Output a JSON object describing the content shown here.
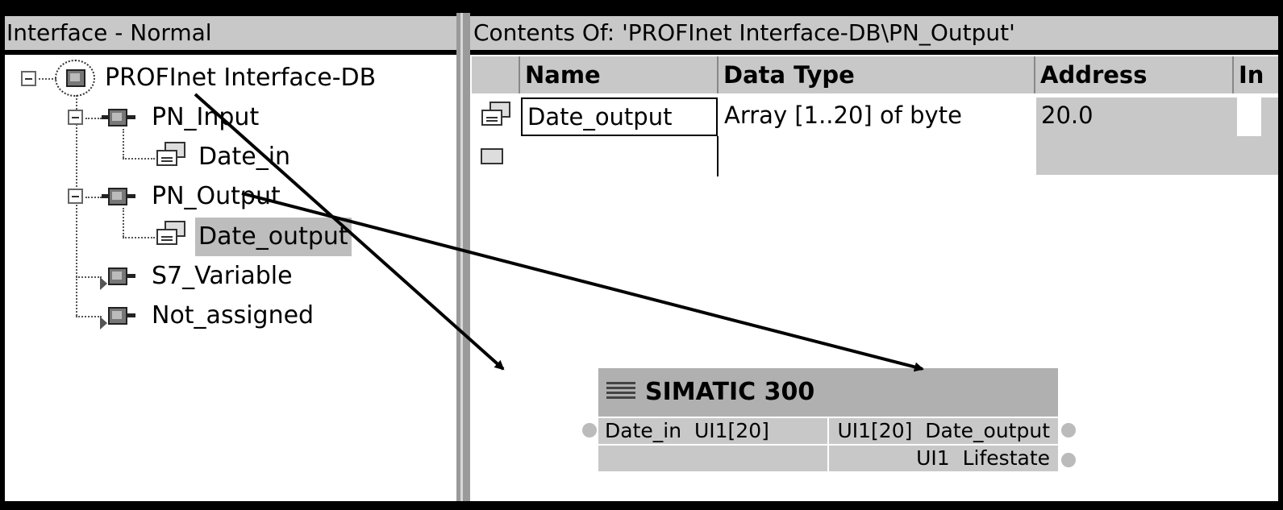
{
  "left_panel": {
    "title": "Interface - Normal",
    "tree": {
      "root": "PROFInet Interface-DB",
      "pn_input": "PN_Input",
      "date_in": "Date_in",
      "pn_output": "PN_Output",
      "date_output": "Date_output",
      "s7_variable": "S7_Variable",
      "not_assigned": "Not_assigned"
    }
  },
  "right_panel": {
    "title": "Contents Of: 'PROFInet Interface-DB\\PN_Output'",
    "table": {
      "columns": [
        "Name",
        "Data Type",
        "Address",
        "In"
      ],
      "rows": [
        {
          "name": "Date_output",
          "data_type": "Array [1..20] of byte",
          "address": "20.0"
        }
      ]
    }
  },
  "block": {
    "title": "SIMATIC 300",
    "input_name": "Date_in",
    "input_type": "UI1[20]",
    "output1_type": "UI1[20]",
    "output1_name": "Date_output",
    "output2_type": "UI1",
    "output2_name": "Lifestate"
  },
  "colors": {
    "panel_header": "#c8c8c8",
    "selection": "#bdbdbd",
    "block_header": "#b0b0b0",
    "frame": "#000000"
  }
}
